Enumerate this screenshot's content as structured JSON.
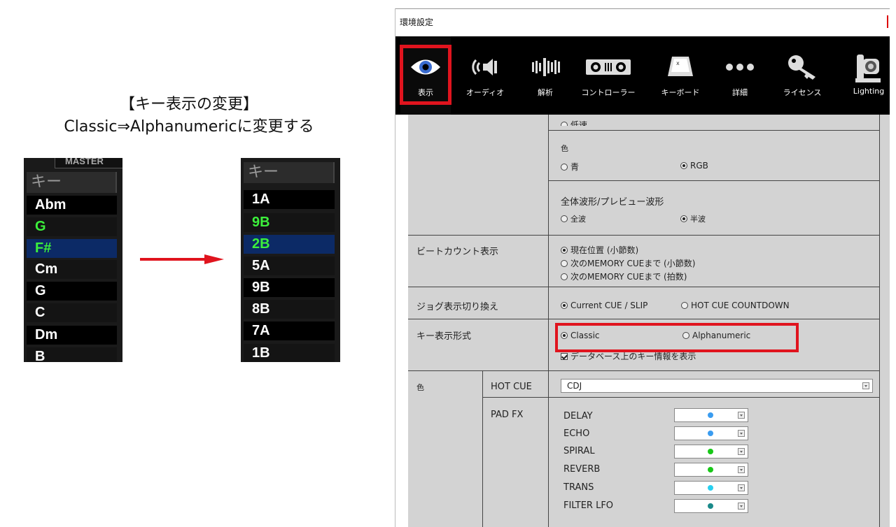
{
  "annotation": {
    "title_line1": "【キー表示の変更】",
    "title_line2": "Classic⇒Alphanumericに変更する"
  },
  "before_list": {
    "master_label": "MASTER",
    "header": "キー",
    "rows": [
      "Abm",
      "G",
      "F#",
      "Cm",
      "G",
      "C",
      "Dm",
      "B"
    ]
  },
  "after_list": {
    "header": "キー",
    "rows": [
      "1A",
      "9B",
      "2B",
      "5A",
      "9B",
      "8B",
      "7A",
      "1B"
    ]
  },
  "colors": {
    "highlight": "#e0141e",
    "key_green": "#3cf03c",
    "selected_row": "#0c2a66",
    "hotcue_dot_blue": "#3a9cf0",
    "dot_green": "#18c818",
    "dot_cyan": "#28d0f0",
    "dot_teal": "#1a8a8a"
  },
  "window": {
    "title": "環境設定",
    "tabs": [
      {
        "label": "表示",
        "icon": "eye-icon"
      },
      {
        "label": "オーディオ",
        "icon": "speaker-icon"
      },
      {
        "label": "解析",
        "icon": "waveform-bars-icon"
      },
      {
        "label": "コントローラー",
        "icon": "controller-icon"
      },
      {
        "label": "キーボード",
        "icon": "keyboard-key-icon"
      },
      {
        "label": "詳細",
        "icon": "more-dots-icon"
      },
      {
        "label": "ライセンス",
        "icon": "key-icon"
      },
      {
        "label": "Lighting",
        "icon": "moving-head-light-icon"
      }
    ],
    "active_tab": "表示"
  },
  "settings": {
    "speed_option_partial": "低速",
    "color_section": {
      "label": "色",
      "options": [
        "青",
        "RGB"
      ],
      "selected": "RGB"
    },
    "waveform_section": {
      "label": "全体波形/プレビュー波形",
      "options": [
        "全波",
        "半波"
      ],
      "selected": "半波"
    },
    "beat_count": {
      "label": "ビートカウント表示",
      "options": [
        "現在位置 (小節数)",
        "次のMEMORY CUEまで (小節数)",
        "次のMEMORY CUEまで (拍数)"
      ],
      "selected": "現在位置 (小節数)"
    },
    "jog_display": {
      "label": "ジョグ表示切り換え",
      "options": [
        "Current CUE / SLIP",
        "HOT CUE COUNTDOWN"
      ],
      "selected": "Current CUE / SLIP"
    },
    "key_format": {
      "label": "キー表示形式",
      "options": [
        "Classic",
        "Alphanumeric"
      ],
      "selected": "Classic",
      "checkbox_label": "データベース上のキー情報を表示",
      "checkbox_checked": true
    },
    "colors": {
      "label": "色",
      "hot_cue": {
        "label": "HOT CUE",
        "value": "CDJ"
      },
      "pad_fx": {
        "label": "PAD FX",
        "items": [
          {
            "name": "DELAY",
            "dot_color": "#3a9cf0"
          },
          {
            "name": "ECHO",
            "dot_color": "#3a9cf0"
          },
          {
            "name": "SPIRAL",
            "dot_color": "#18c818"
          },
          {
            "name": "REVERB",
            "dot_color": "#18c818"
          },
          {
            "name": "TRANS",
            "dot_color": "#28d0f0"
          },
          {
            "name": "FILTER LFO",
            "dot_color": "#1a8a8a"
          }
        ]
      }
    }
  }
}
